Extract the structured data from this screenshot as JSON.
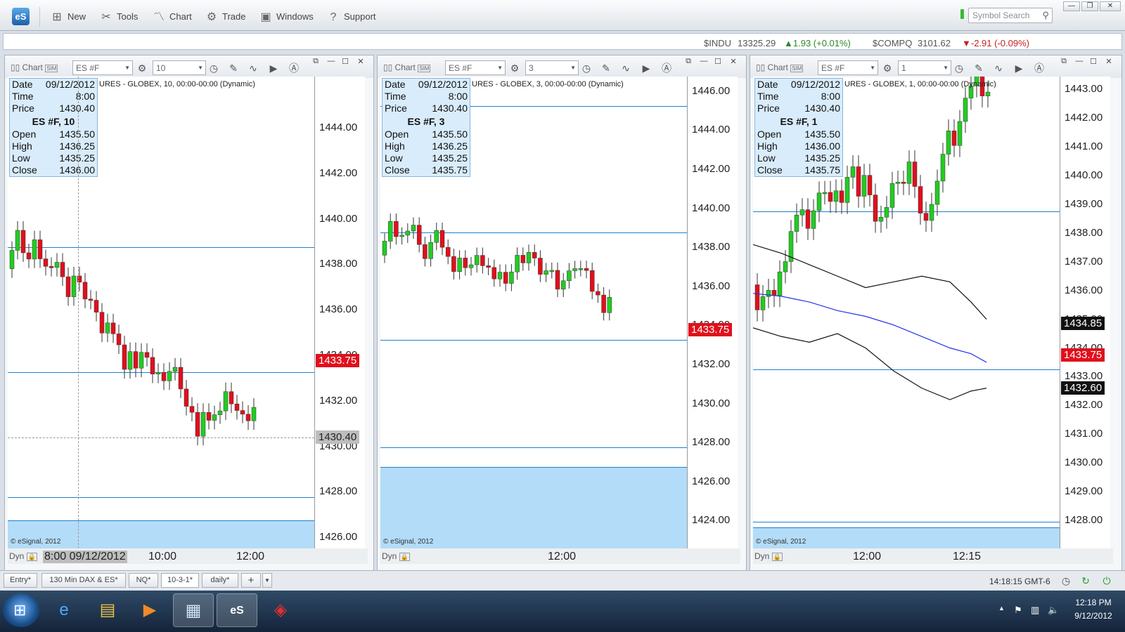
{
  "app": {
    "logo": "eS"
  },
  "menu": [
    {
      "label": "New",
      "icon": "new-icon"
    },
    {
      "label": "Tools",
      "icon": "tools-icon"
    },
    {
      "label": "Chart",
      "icon": "chart-icon"
    },
    {
      "label": "Trade",
      "icon": "trade-icon"
    },
    {
      "label": "Windows",
      "icon": "windows-icon"
    },
    {
      "label": "Support",
      "icon": "support-icon"
    }
  ],
  "search": {
    "placeholder": "Symbol Search"
  },
  "tickers": [
    {
      "symbol": "$INDU",
      "price": "13325.29",
      "change": "▲1.93 (+0.01%)",
      "dir": "up"
    },
    {
      "symbol": "$COMPQ",
      "price": "3101.62",
      "change": "▼-2.91 (-0.09%)",
      "dir": "down"
    }
  ],
  "colors": {
    "accent": "#1e7fd0",
    "up": "#22cc22",
    "down": "#e0101c",
    "zone": "#b3dcf8"
  },
  "panels": [
    {
      "title": "Chart",
      "symbol": "ES #F",
      "interval": "10",
      "header": "URES - GLOBEX, 10, 00:00-00:00 (Dynamic)",
      "info": {
        "date_label": "Date",
        "date": "09/12/2012",
        "time_label": "Time",
        "time": "8:00",
        "price_label": "Price",
        "price": "1430.40",
        "name": "ES #F, 10",
        "open_label": "Open",
        "open": "1435.50",
        "high_label": "High",
        "high": "1436.25",
        "low_label": "Low",
        "low": "1435.25",
        "close_label": "Close",
        "close": "1436.00"
      },
      "axis": [
        "1444.00",
        "1442.00",
        "1440.00",
        "1438.00",
        "1436.00",
        "1434.00",
        "1432.00",
        "1430.00",
        "1428.00",
        "1426.00"
      ],
      "last_price": "1433.75",
      "cursor_price": "1430.40",
      "time_labels": [
        "8:00 09/12/2012",
        "10:00",
        "12:00"
      ],
      "copyright": "© eSignal, 2012",
      "dyn": "Dyn"
    },
    {
      "title": "Chart",
      "symbol": "ES #F",
      "interval": "3",
      "header": "URES - GLOBEX, 3, 00:00-00:00 (Dynamic)",
      "info": {
        "date_label": "Date",
        "date": "09/12/2012",
        "time_label": "Time",
        "time": "8:00",
        "price_label": "Price",
        "price": "1430.40",
        "name": "ES #F, 3",
        "open_label": "Open",
        "open": "1435.50",
        "high_label": "High",
        "high": "1436.25",
        "low_label": "Low",
        "low": "1435.25",
        "close_label": "Close",
        "close": "1435.75"
      },
      "axis": [
        "1446.00",
        "1444.00",
        "1442.00",
        "1440.00",
        "1438.00",
        "1436.00",
        "1434.00",
        "1432.00",
        "1430.00",
        "1428.00",
        "1426.00",
        "1424.00"
      ],
      "last_price": "1433.75",
      "time_labels": [
        "12:00"
      ],
      "copyright": "© eSignal, 2012",
      "dyn": "Dyn"
    },
    {
      "title": "Chart",
      "symbol": "ES #F",
      "interval": "1",
      "header": "URES - GLOBEX, 1, 00:00-00:00 (Dynamic)",
      "info": {
        "date_label": "Date",
        "date": "09/12/2012",
        "time_label": "Time",
        "time": "8:00",
        "price_label": "Price",
        "price": "1430.40",
        "name": "ES #F, 1",
        "open_label": "Open",
        "open": "1435.50",
        "high_label": "High",
        "high": "1436.00",
        "low_label": "Low",
        "low": "1435.25",
        "close_label": "Close",
        "close": "1435.75"
      },
      "axis": [
        "1443.00",
        "1442.00",
        "1441.00",
        "1440.00",
        "1439.00",
        "1438.00",
        "1437.00",
        "1436.00",
        "1435.00",
        "1434.00",
        "1433.00",
        "1432.00",
        "1431.00",
        "1430.00",
        "1429.00",
        "1428.00"
      ],
      "last_price": "1433.75",
      "upper_band": "1434.85",
      "lower_band": "1432.60",
      "time_labels": [
        "12:00",
        "12:15"
      ],
      "copyright": "© eSignal, 2012",
      "dyn": "Dyn"
    }
  ],
  "tabs": [
    "Entry*",
    "130 Min DAX & ES*",
    "NQ*",
    "10-3-1*",
    "daily*",
    "+"
  ],
  "status": {
    "clock": "14:18:15 GMT-6"
  },
  "system": {
    "time": "12:18 PM",
    "date": "9/12/2012"
  }
}
